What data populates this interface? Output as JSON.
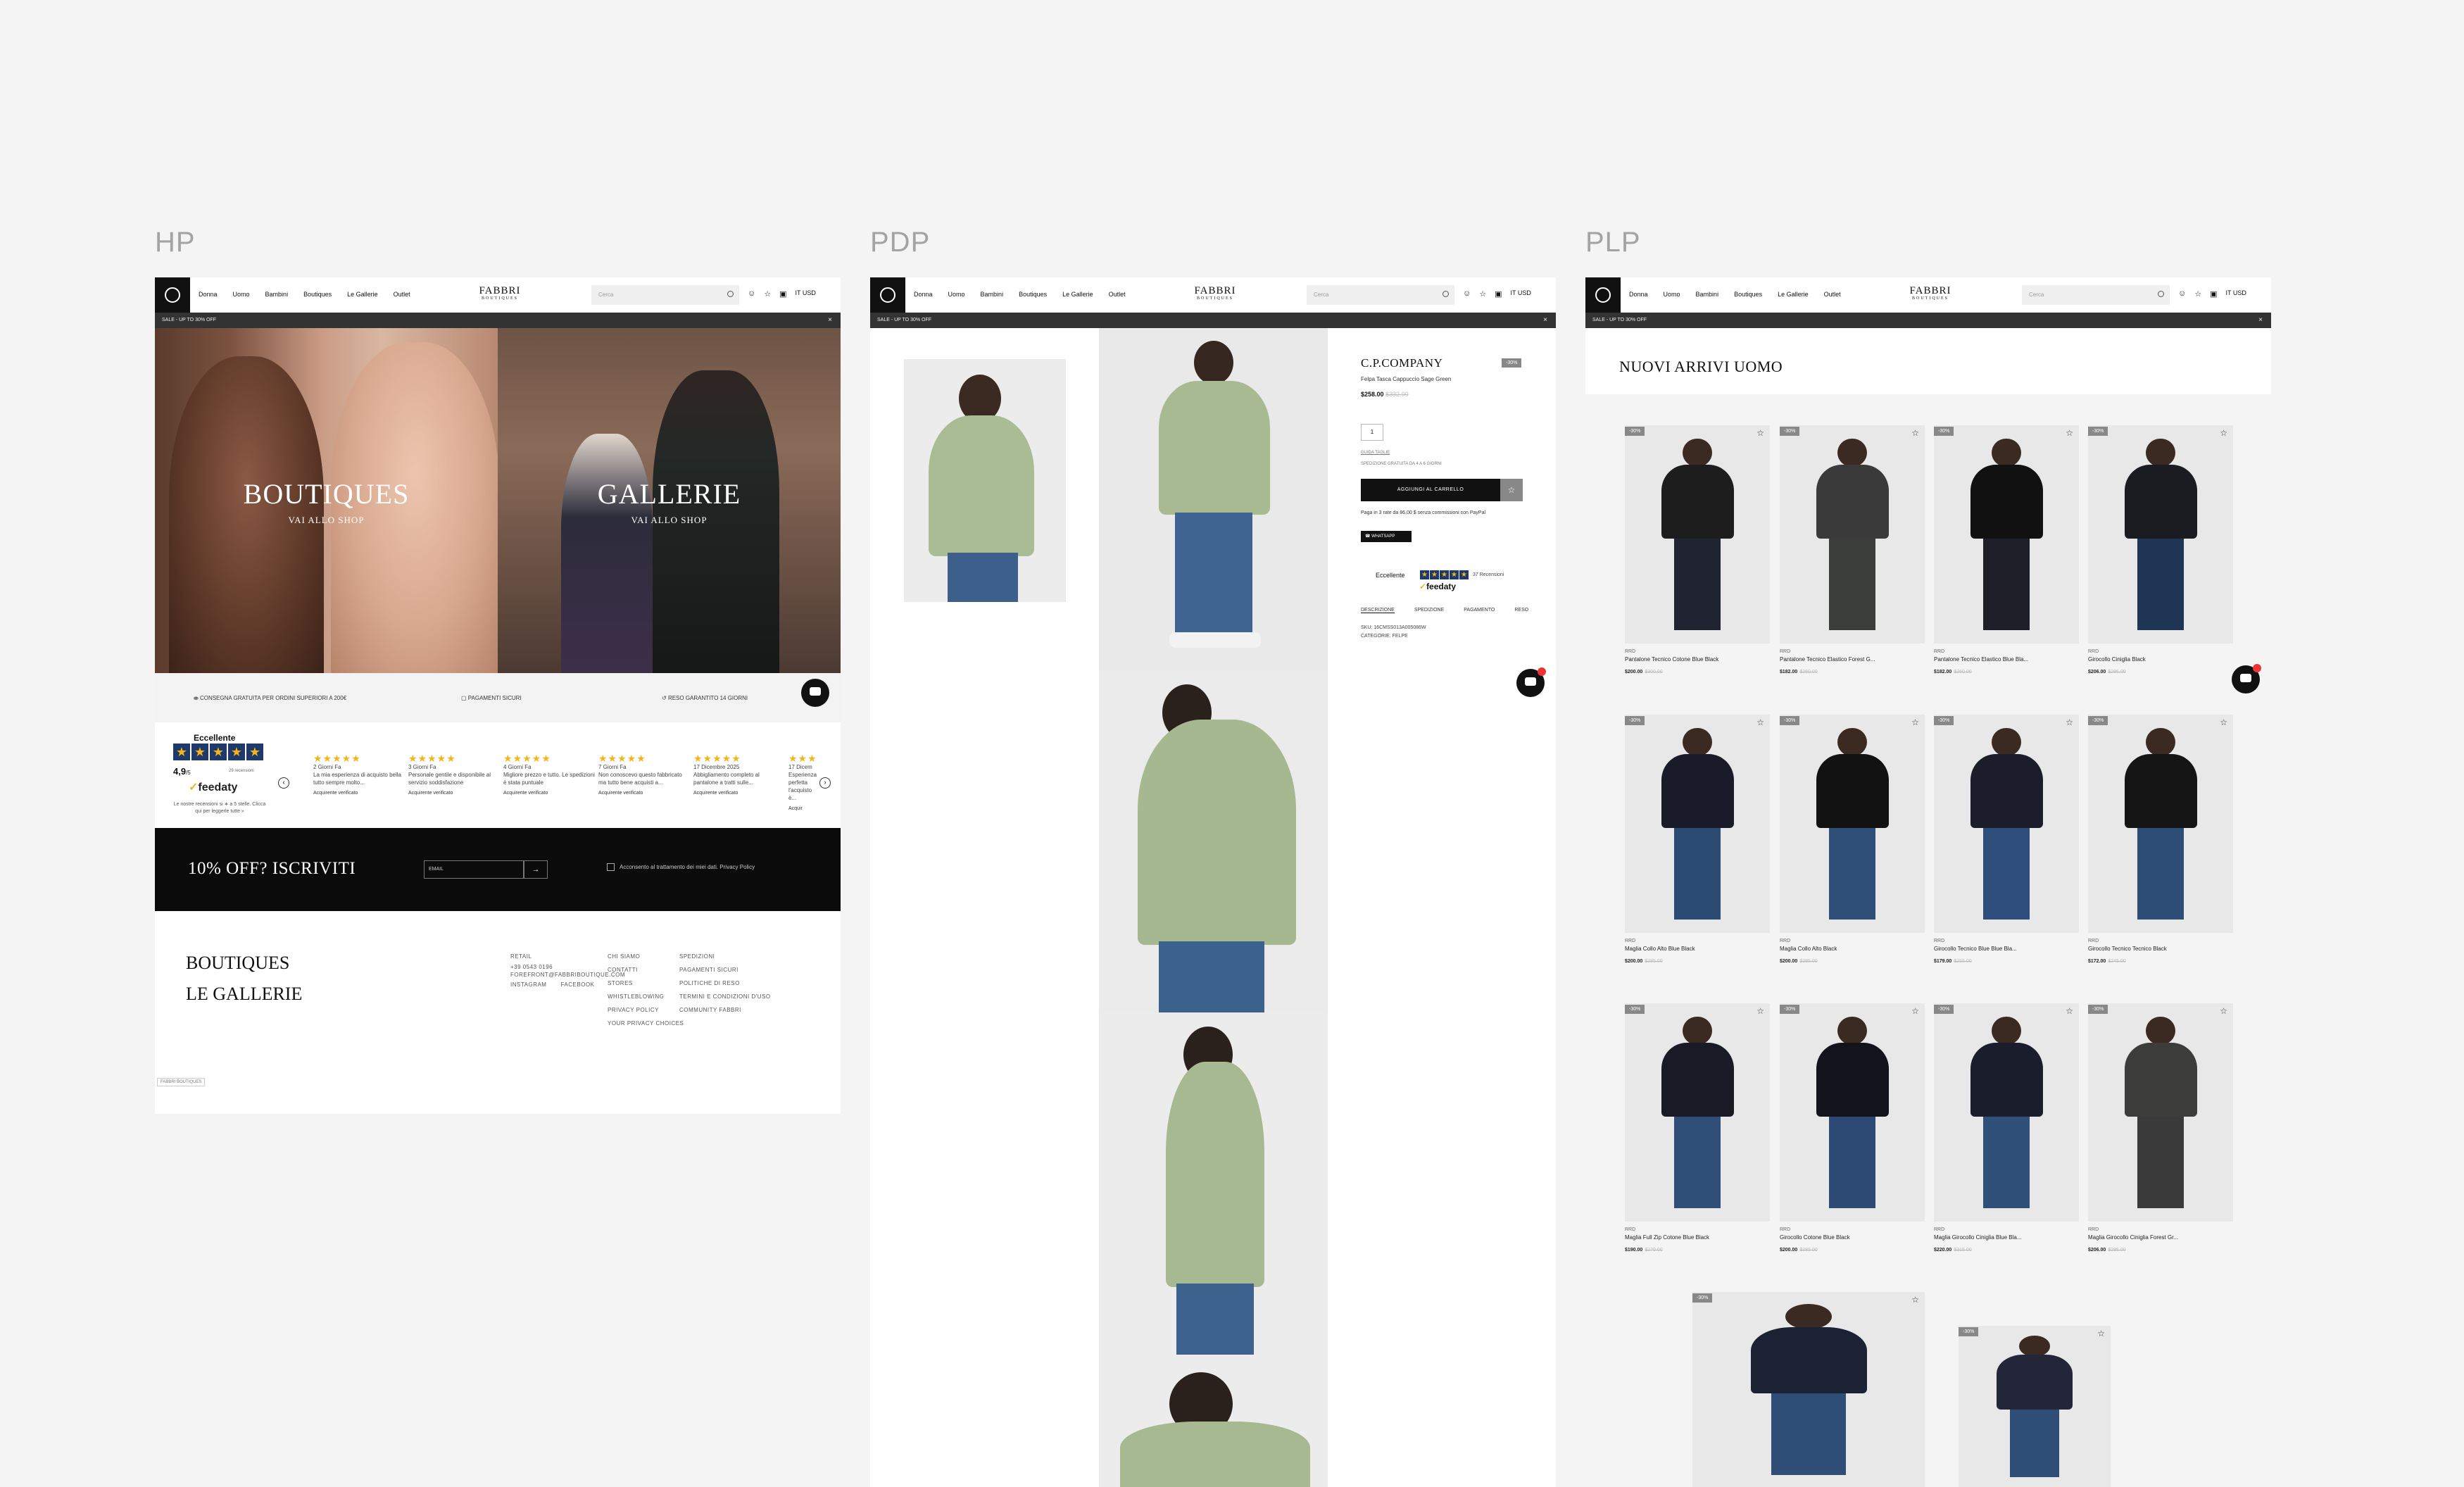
{
  "labels": {
    "hp": "HP",
    "pdp": "PDP",
    "plp": "PLP"
  },
  "nav": {
    "menu": [
      "Donna",
      "Uomo",
      "Bambini",
      "Boutiques",
      "Le Gallerie",
      "Outlet"
    ],
    "brand": "FABBRI",
    "brand_sub": "BOUTIQUES",
    "search_placeholder": "Cerca",
    "lang": "IT USD"
  },
  "promo": {
    "text": "SALE - UP TO 30% OFF",
    "close": "×"
  },
  "hp": {
    "hero_left": {
      "title": "BOUTIQUES",
      "sub": "VAI ALLO SHOP"
    },
    "hero_right": {
      "title": "GALLERIE",
      "sub": "VAI ALLO SHOP"
    },
    "usp": [
      "CONSEGNA GRATUITA PER ORDINI SUPERIORI A 200€",
      "PAGAMENTI SICURI",
      "RESO GARANTITO 14 GIORNI"
    ],
    "reviews": {
      "heading": "Eccellente",
      "score": "4,9",
      "score_suffix": "/5",
      "count": "29 recensioni",
      "brand": "feedaty",
      "footnote": "Le nostre recensioni si ∗ a 5 stelle. Clicca qui per leggerle tutte »",
      "items": [
        {
          "date": "2 Giorni Fa",
          "text": "La mia esperienza di acquisto bella tutto sempre molto...",
          "verified": "Acquirente verificato"
        },
        {
          "date": "3 Giorni Fa",
          "text": "Personale gentile e disponibile al servizio soddisfazione",
          "verified": "Acquirente verificato"
        },
        {
          "date": "4 Giorni Fa",
          "text": "Migliore prezzo e tutto. Le spedizioni è stata puntuale",
          "verified": "Acquirente verificato"
        },
        {
          "date": "7 Giorni Fa",
          "text": "Non conoscevo questo fabbricato ma tutto bene acquisti a...",
          "verified": "Acquirente verificato"
        },
        {
          "date": "17 Dicembre 2025",
          "text": "Abbigliamento completo al pantalone a tratti sulle...",
          "verified": "Acquirente verificato"
        },
        {
          "date": "17 Dicem",
          "text": "Esperienza perfetta l'acquisto è...",
          "verified": "Acquir"
        }
      ]
    },
    "newsletter": {
      "title": "10% OFF? ISCRIVITI",
      "placeholder": "EMAIL",
      "submit": "→",
      "consent": "Acconsento al trattamento dei miei dati. Privacy Policy"
    },
    "footer": {
      "brands": [
        "BOUTIQUES",
        "LE GALLERIE"
      ],
      "col1": [
        "RETAIL",
        "+39 0543 0196",
        "FOREFRONT@FABBRIBOUTIQUE.COM",
        "INSTAGRAM",
        "FACEBOOK"
      ],
      "col2": [
        "CHI SIAMO",
        "CONTATTI",
        "STORES",
        "WHISTLEBLOWING",
        "PRIVACY POLICY",
        "YOUR PRIVACY CHOICES"
      ],
      "col3": [
        "SPEDIZIONI",
        "PAGAMENTI SICURI",
        "POLITICHE DI RESO",
        "TERMINI E CONDIZIONI D'USO",
        "COMMUNITY FABBRI"
      ],
      "bottom": "FABBRI BOUTIQUES"
    }
  },
  "pdp": {
    "brand": "C.P.COMPANY",
    "badge": "-30%",
    "name": "Felpa Tasca Cappuccio Sage Green",
    "price": "$258.00",
    "old_price": "$332.00",
    "qty": "1",
    "size_label": "GUIDA TAGLIE",
    "availability": "SPEDIZIONE GRATUITA DA 4 A 6 GIORNI",
    "add_to_cart": "AGGIUNGI AL CARRELLO",
    "paypal_text": "Paga in 3 rate da 86,00 $ senza commissioni con PayPal",
    "paypal": "PayPal",
    "whatsapp": "WHATSAPP",
    "rating_label": "Eccellente",
    "rating_count": "37 Recensioni",
    "rating_brand": "feedaty",
    "tabs": [
      "DESCRIZIONE",
      "SPEDIZIONE",
      "PAGAMENTO",
      "RESO"
    ],
    "desc": [
      "SKU: 16CMSS013A005086W",
      "CATEGORIE: FELPE"
    ]
  },
  "plp": {
    "title": "NUOVI ARRIVI UOMO",
    "badge": "-30%",
    "products": [
      {
        "brand": "RRD",
        "name": "Pantalone Tecnico Cotone Blue Black",
        "price": "$200.00",
        "old": "$300.00",
        "bg": "#1d1d1d",
        "pant": "#1f2430"
      },
      {
        "brand": "RRD",
        "name": "Pantalone Tecnico Elastico Forest G...",
        "price": "$182.00",
        "old": "$260.00",
        "bg": "#3a3a3a",
        "pant": "#3b3d3a"
      },
      {
        "brand": "RRD",
        "name": "Pantalone Tecnico Elastico Blue Bla...",
        "price": "$182.00",
        "old": "$260.00",
        "bg": "#111111",
        "pant": "#1d2028"
      },
      {
        "brand": "RRD",
        "name": "Girocollo Ciniglia Black",
        "price": "$206.00",
        "old": "$295.00",
        "bg": "#1a1c22",
        "pant": "#1e3555"
      },
      {
        "brand": "RRD",
        "name": "Maglia Collo Alto Blue Black",
        "price": "$200.00",
        "old": "$285.00",
        "bg": "#191b29",
        "pant": "#2c4b73"
      },
      {
        "brand": "RRD",
        "name": "Maglia Collo Alto Black",
        "price": "$200.00",
        "old": "$285.00",
        "bg": "#121212",
        "pant": "#2f4f79"
      },
      {
        "brand": "RRD",
        "name": "Girocollo Tecnico Blue Blue Bla...",
        "price": "$179.00",
        "old": "$255.00",
        "bg": "#1b1d2b",
        "pant": "#2e4e7b"
      },
      {
        "brand": "RRD",
        "name": "Girocollo Tecnico Tecnico Black",
        "price": "$172.00",
        "old": "$245.00",
        "bg": "#141414",
        "pant": "#2d4d77"
      },
      {
        "brand": "RRD",
        "name": "Maglia Full Zip Cotone Blue Black",
        "price": "$190.00",
        "old": "$270.00",
        "bg": "#181a26",
        "pant": "#2f4f79"
      },
      {
        "brand": "RRD",
        "name": "Girocollo Cotone Blue Black",
        "price": "$200.00",
        "old": "$285.00",
        "bg": "#13141b",
        "pant": "#2c4a73"
      },
      {
        "brand": "RRD",
        "name": "Maglia Girocollo Ciniglia Blue Bla...",
        "price": "$220.00",
        "old": "$315.00",
        "bg": "#1a1d2c",
        "pant": "#2f5079"
      },
      {
        "brand": "RRD",
        "name": "Maglia Girocollo Ciniglia Forest Gr...",
        "price": "$206.00",
        "old": "$295.00",
        "bg": "#3c3d3b",
        "pant": "#3a3a3a"
      },
      {
        "brand": "",
        "name": "",
        "price": "",
        "old": "",
        "bg": "#1b2234",
        "pant": "#2e4d77"
      },
      {
        "brand": "",
        "name": "",
        "price": "",
        "old": "",
        "bg": "#232638",
        "pant": "#2e4d77"
      }
    ]
  }
}
